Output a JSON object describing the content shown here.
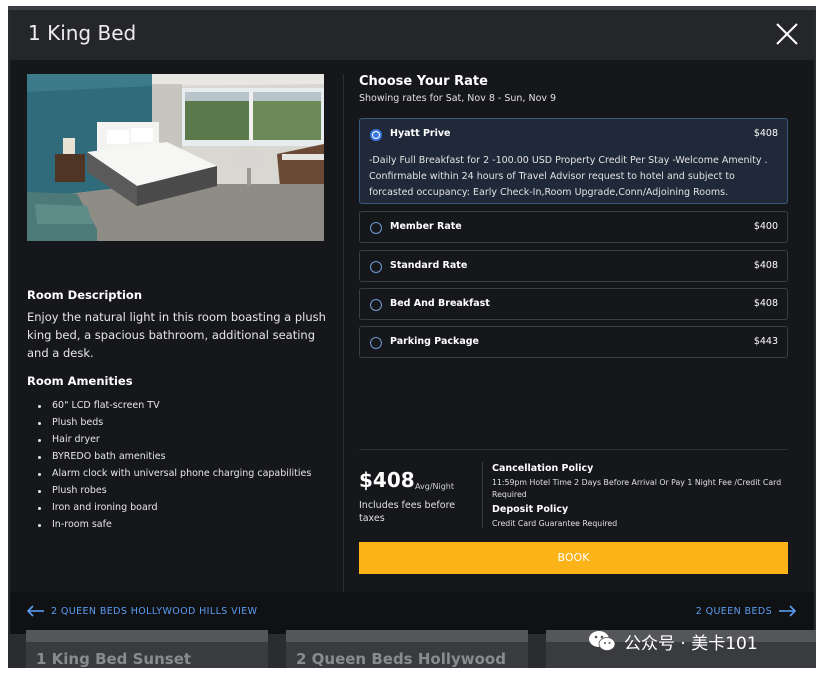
{
  "modal": {
    "title": "1 King Bed"
  },
  "room": {
    "description_heading": "Room Description",
    "description_text": "Enjoy the natural light in this room boasting a plush king bed, a spacious bathroom, additional seating and a desk.",
    "amenities_heading": "Room Amenities",
    "amenities": [
      "60\" LCD flat-screen TV",
      "Plush beds",
      "Hair dryer",
      "BYREDO bath amenities",
      "Alarm clock with universal phone charging capabilities",
      "Plush robes",
      "Iron and ironing board",
      "In-room safe"
    ]
  },
  "rates": {
    "heading": "Choose Your Rate",
    "subheading": "Showing rates for Sat, Nov 8 - Sun, Nov 9",
    "options": [
      {
        "name": "Hyatt Prive",
        "price": "$408",
        "selected": true,
        "detail": "-Daily Full Breakfast for 2 -100.00 USD Property Credit Per Stay -Welcome Amenity . Confirmable within 24 hours of Travel Advisor request to hotel and subject to forcasted occupancy: Early Check-In,Room Upgrade,Conn/Adjoining Rooms."
      },
      {
        "name": "Member Rate",
        "price": "$400",
        "selected": false
      },
      {
        "name": "Standard Rate",
        "price": "$408",
        "selected": false
      },
      {
        "name": "Bed And Breakfast",
        "price": "$408",
        "selected": false
      },
      {
        "name": "Parking Package",
        "price": "$443",
        "selected": false
      }
    ]
  },
  "summary": {
    "price": "$408",
    "price_unit": "Avg/Night",
    "price_note": "Includes fees before taxes",
    "cancellation_heading": "Cancellation Policy",
    "cancellation_text": "11:59pm Hotel Time 2 Days Before Arrival Or Pay 1 Night Fee /Credit Card Required",
    "deposit_heading": "Deposit Policy",
    "deposit_text": "Credit Card Guarantee Required",
    "book_label": "BOOK"
  },
  "footer": {
    "prev_label": "2 QUEEN BEDS HOLLYWOOD HILLS VIEW",
    "next_label": "2 QUEEN BEDS"
  },
  "background_cards": [
    "1 King Bed Sunset",
    "2 Queen Beds Hollywood"
  ],
  "watermark": "公众号 · 美卡101",
  "colors": {
    "modal_bg": "#16171a",
    "header_bg": "#25262a",
    "accent_blue": "#5b9cf2",
    "book_button": "#fbb317",
    "selected_card": "#1f2939"
  },
  "icons": {
    "close": "close-icon",
    "prev": "arrow-left-icon",
    "next": "arrow-right-icon",
    "radio": "radio-icon",
    "watermark": "wechat-logo-icon"
  }
}
